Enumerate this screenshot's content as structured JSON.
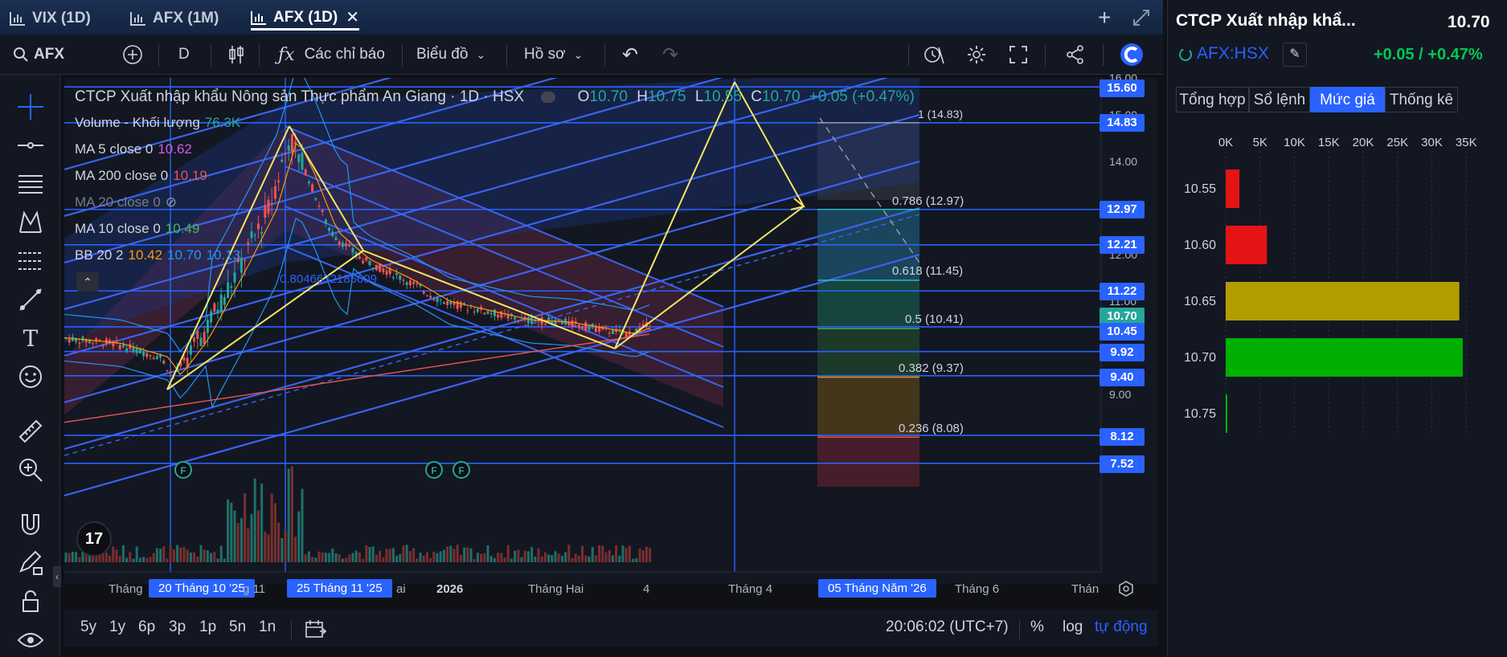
{
  "tabs": [
    {
      "label": "VIX (1D)",
      "active": false
    },
    {
      "label": "AFX (1M)",
      "active": false
    },
    {
      "label": "AFX (1D)",
      "active": true
    }
  ],
  "toolbar": {
    "symbol": "AFX",
    "interval": "D",
    "indicators_label": "Các chỉ báo",
    "chart_label": "Biểu đồ",
    "profile_label": "Hồ sơ"
  },
  "legend": {
    "title": "CTCP Xuất nhập khẩu Nông sản Thực phẩm An Giang · 1D · HSX",
    "ohlc": {
      "o_label": "O",
      "o": "10.70",
      "h_label": "H",
      "h": "10.75",
      "l_label": "L",
      "l": "10.55",
      "c_label": "C",
      "c": "10.70",
      "chg": "+0.05 (+0.47%)"
    },
    "volume": {
      "label": "Volume - Khối lượng",
      "value": "76.3K"
    },
    "ma5": {
      "label": "MA 5 close 0",
      "value": "10.62"
    },
    "ma200": {
      "label": "MA 200 close 0",
      "value": "10.19"
    },
    "ma20": {
      "label": "MA 20 close 0"
    },
    "ma10": {
      "label": "MA 10 close 0",
      "value": "10.49"
    },
    "bb": {
      "label": "BB 20 2",
      "v1": "10.42",
      "v2": "10.70",
      "v3": "10.13"
    }
  },
  "colors": {
    "bg": "#131722",
    "accent": "#2962ff",
    "up": "#26a69a",
    "down": "#ef5350",
    "drawing": "#f5e663",
    "fib": "#4b6cf7"
  },
  "fib_labels": [
    {
      "text": "1 (14.83)",
      "color": "#9aa0aa"
    },
    {
      "text": "0.786 (12.97)",
      "color": "#2bc4d8"
    },
    {
      "text": "0.618 (11.45)",
      "color": "#2bc4d8"
    },
    {
      "text": "0.5 (10.41)",
      "color": "#4caf50"
    },
    {
      "text": "0.382 (9.37)",
      "color": "#ff9800"
    },
    {
      "text": "0.236 (8.08)",
      "color": "#ef5350"
    }
  ],
  "price_tags": [
    "15.60",
    "14.83",
    "12.97",
    "12.21",
    "11.22",
    "10.70",
    "10.45",
    "9.92",
    "9.40",
    "8.12",
    "7.52"
  ],
  "price_scale": [
    "16.00",
    "15.00",
    "14.00",
    "12.00",
    "11.00",
    "9.00",
    "8.00"
  ],
  "extra_text": "0.8046632185609",
  "time_axis": [
    {
      "text": "Tháng",
      "hl": false
    },
    {
      "text": "20 Tháng 10 '25",
      "hl": true
    },
    {
      "text": "g 11",
      "hl": false
    },
    {
      "text": "25 Tháng 11 '25",
      "hl": true
    },
    {
      "text": "ai",
      "hl": false
    },
    {
      "text": "2026",
      "hl": false
    },
    {
      "text": "Tháng Hai",
      "hl": false
    },
    {
      "text": "4",
      "hl": false
    },
    {
      "text": "Tháng 4",
      "hl": false
    },
    {
      "text": "05 Tháng Năm '26",
      "hl": true
    },
    {
      "text": "Tháng 6",
      "hl": false
    },
    {
      "text": "Thán",
      "hl": false
    }
  ],
  "bottom": {
    "ranges": [
      "5y",
      "1y",
      "6p",
      "3p",
      "1p",
      "5n",
      "1n"
    ],
    "time": "20:06:02 (UTC+7)",
    "pct": "%",
    "log": "log",
    "auto": "tự động"
  },
  "right": {
    "company": "CTCP Xuất nhập khẩ...",
    "price": "10.70",
    "ticker": "AFX:HSX",
    "change": "+0.05 / +0.47%",
    "tabs": [
      {
        "label": "Tổng hợp",
        "active": false
      },
      {
        "label": "Sổ lệnh",
        "active": false
      },
      {
        "label": "Mức giá",
        "active": true
      },
      {
        "label": "Thống kê",
        "active": false
      }
    ],
    "x_axis": [
      "0K",
      "5K",
      "10K",
      "15K",
      "20K",
      "25K",
      "30K",
      "35K"
    ],
    "levels": [
      {
        "price": "10.55",
        "volume": 2000,
        "color": "#e51414"
      },
      {
        "price": "10.60",
        "volume": 6000,
        "color": "#e51414"
      },
      {
        "price": "10.65",
        "volume": 34000,
        "color": "#b39c00"
      },
      {
        "price": "10.70",
        "volume": 34500,
        "color": "#00b000"
      },
      {
        "price": "10.75",
        "volume": 200,
        "color": "#00b000"
      }
    ]
  },
  "chart_data": {
    "type": "table",
    "title": "CTCP Xuất nhập khẩu Nông sản Thực phẩm An Giang · 1D · HSX",
    "price_ticks": [
      16.0,
      15.0,
      14.0,
      12.0,
      11.0,
      9.0,
      8.0
    ]
  }
}
